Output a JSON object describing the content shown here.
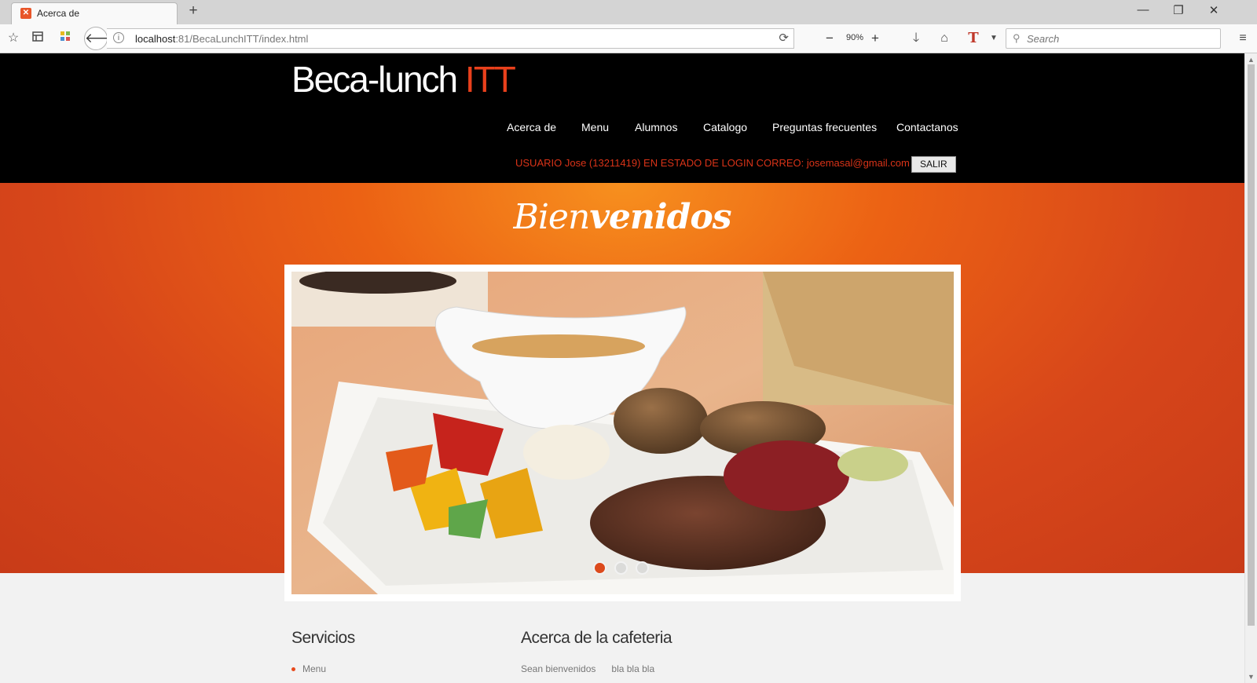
{
  "browser": {
    "tab_title": "Acerca de",
    "new_tab_glyph": "+",
    "url_host": "localhost",
    "url_path": ":81/BecaLunchITT/index.html",
    "zoom": "90%",
    "search_placeholder": "Search",
    "window_controls": [
      "—",
      "❐",
      "✕"
    ]
  },
  "site": {
    "logo_main": "Beca-lunch ",
    "logo_accent": "ITT",
    "accent_color": "#e8401c",
    "nav": [
      "Acerca de",
      "Menu",
      "Alumnos",
      "Catalogo",
      "Preguntas frecuentes",
      "Contactanos"
    ],
    "status_text": "USUARIO Jose (13211419) EN ESTADO DE LOGIN CORREO: josemasal@gmail.com",
    "logout_label": "SALIR"
  },
  "hero": {
    "welcome_part1": "Bien",
    "welcome_part2": "venidos",
    "slides_total": 3,
    "active_slide": 1
  },
  "sections": {
    "services_title": "Servicios",
    "services_first": "Menu",
    "about_title": "Acerca de la cafeteria",
    "about_text": "Sean bienvenidos      bla bla bla"
  }
}
